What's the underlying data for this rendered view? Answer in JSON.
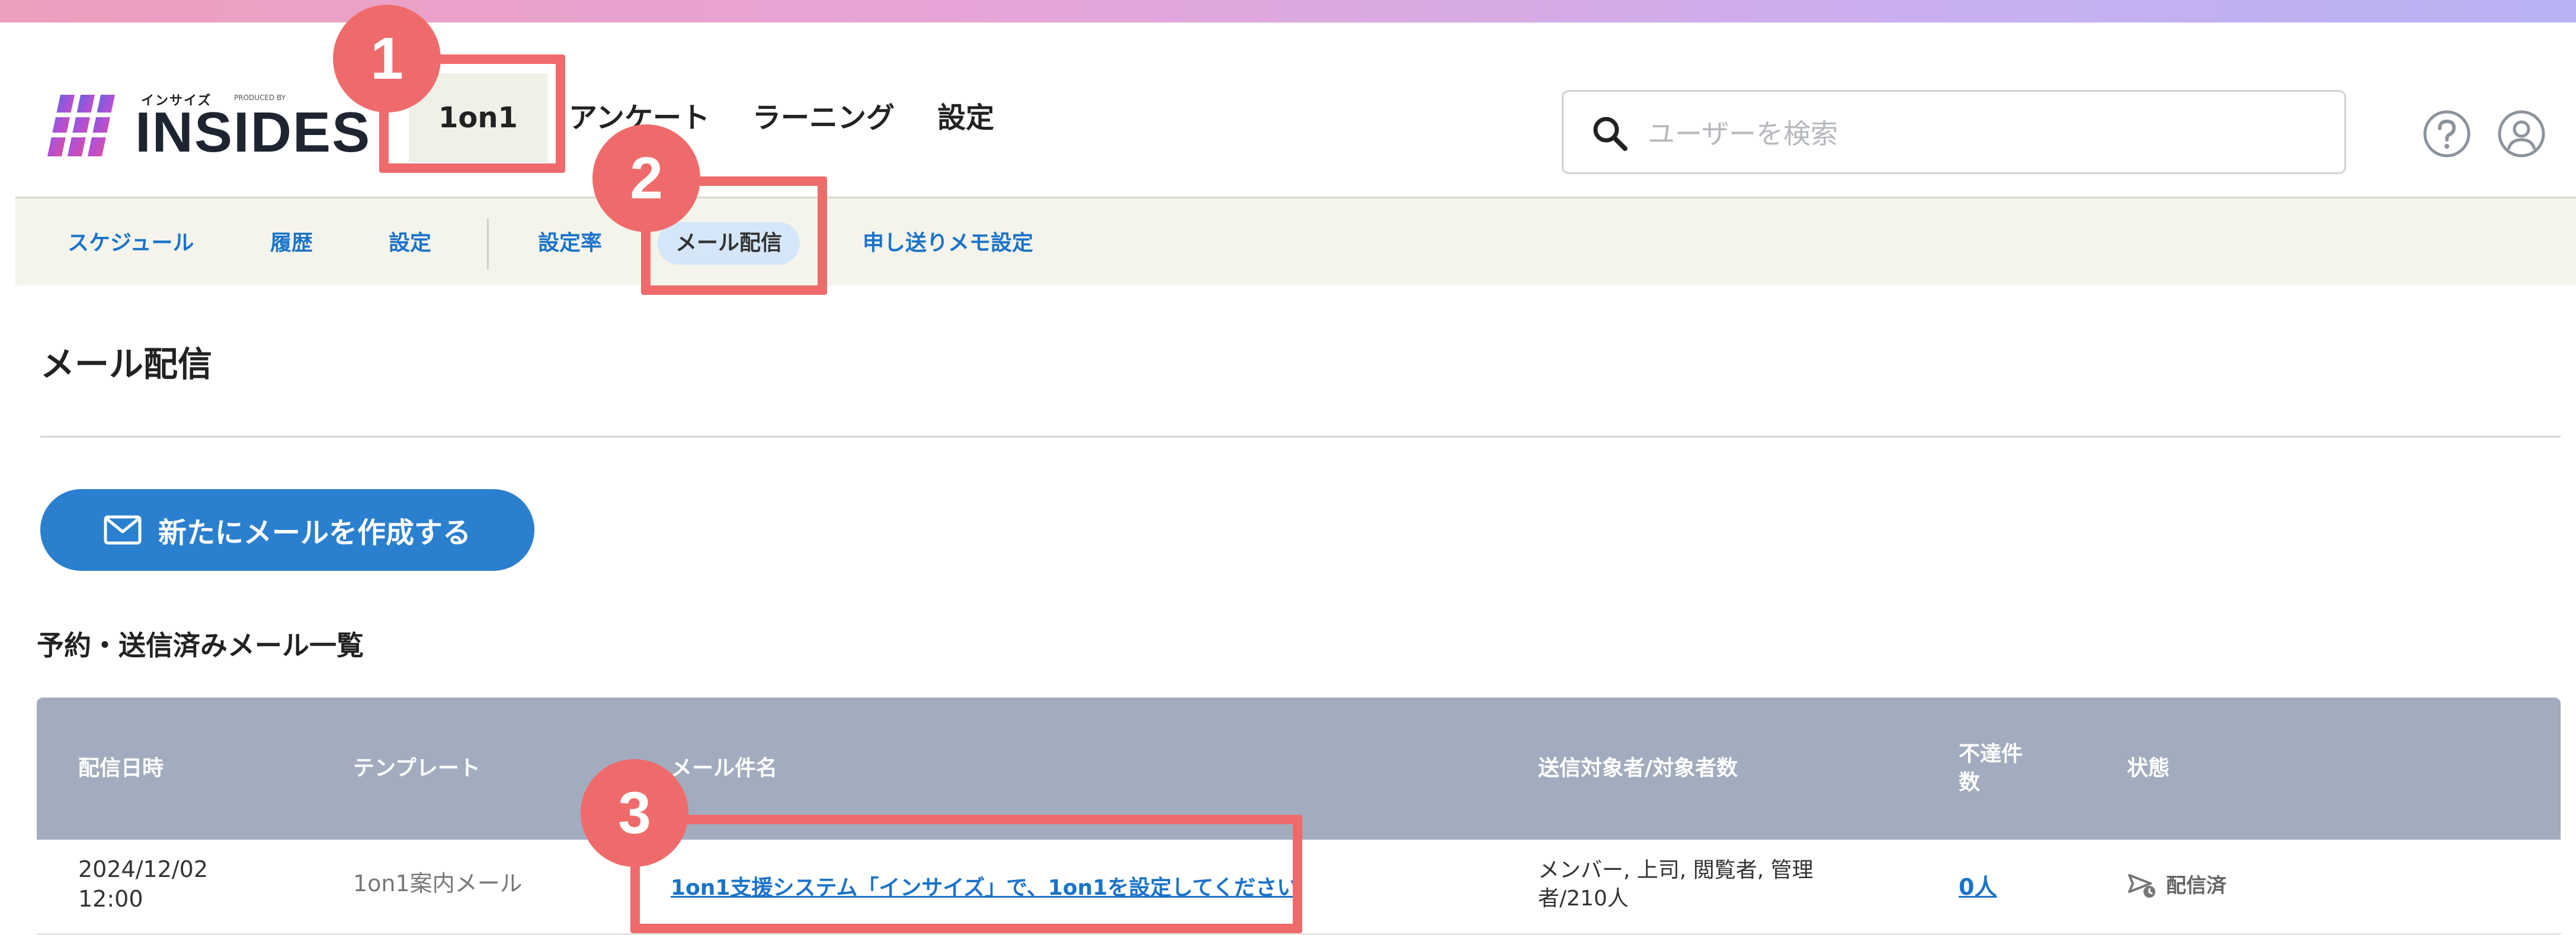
{
  "header": {
    "logo": {
      "kana": "インサイズ",
      "produced_by": "PRODUCED BY",
      "wordmark": "INSIDES"
    },
    "nav": [
      {
        "label": "1on1",
        "active": true
      },
      {
        "label": "アンケート",
        "active": false
      },
      {
        "label": "ラーニング",
        "active": false
      },
      {
        "label": "設定",
        "active": false
      }
    ],
    "search": {
      "placeholder": "ユーザーを検索",
      "value": ""
    },
    "icons": {
      "search": "search-icon",
      "help": "help-circle-icon",
      "user": "user-account-icon"
    }
  },
  "subnav": {
    "items": [
      {
        "label": "スケジュール",
        "active": false
      },
      {
        "label": "履歴",
        "active": false
      },
      {
        "label": "設定",
        "active": false
      },
      {
        "label": "設定率",
        "active": false
      },
      {
        "label": "メール配信",
        "active": true
      },
      {
        "label": "申し送りメモ設定",
        "active": false
      }
    ]
  },
  "main": {
    "title": "メール配信",
    "create_button": {
      "label": "新たにメールを作成する",
      "icon": "mail-icon"
    },
    "list_heading": "予約・送信済みメール一覧",
    "table": {
      "columns": [
        "配信日時",
        "テンプレート",
        "メール件名",
        "送信対象者/対象者数",
        "不達件数",
        "状態"
      ],
      "rows": [
        {
          "date": "2024/12/02",
          "time": "12:00",
          "template": "1on1案内メール",
          "subject": "1on1支援システム「インサイズ」で、1on1を設定してください",
          "recipients_line1": "メンバー, 上司, 閲覧者, 管理",
          "recipients_line2": "者/210人",
          "undelivered": "0人",
          "status": "配信済",
          "status_icon": "sent-status-icon"
        }
      ]
    }
  },
  "annotations": [
    {
      "number": "1",
      "target": "1on1"
    },
    {
      "number": "2",
      "target": "メール配信"
    },
    {
      "number": "3",
      "target": "1on1支援システム「インサイズ」で、1on1を設定してください"
    }
  ],
  "colors": {
    "accent_blue": "#2a7fcf",
    "link_blue": "#1a73c9",
    "table_header": "#a2acbe",
    "subnav_bg": "#f5f4ec",
    "annotation_red": "#ef6b6b"
  }
}
